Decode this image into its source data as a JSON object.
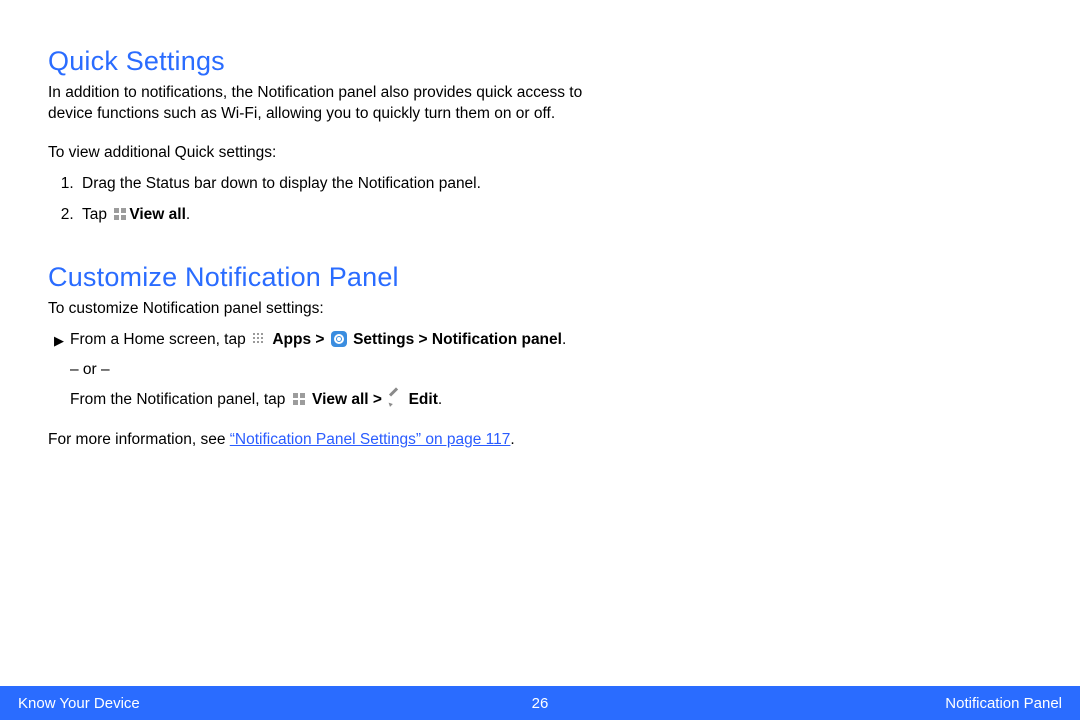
{
  "section1": {
    "heading": "Quick Settings",
    "intro": "In addition to notifications, the Notification panel also provides quick access to device functions such as Wi-Fi, allowing you to quickly turn them on or off.",
    "lead": "To view additional Quick settings:",
    "step1": "Drag the Status bar down to display the Notification panel.",
    "step2_pre": "Tap ",
    "step2_bold": "View all",
    "step2_post": "."
  },
  "section2": {
    "heading": "Customize Notification Panel",
    "lead": "To customize Notification panel settings:",
    "linePrefix": "From a Home screen, tap ",
    "apps": "Apps",
    "gt1": " > ",
    "settings": "Settings",
    "gt2": " > ",
    "notifpanel": "Notification panel",
    "dot1": ".",
    "or": "– or –",
    "alt_pre": "From the Notification panel, tap ",
    "viewall": "View all",
    "gt3": " > ",
    "edit": "Edit",
    "dot2": ".",
    "moreinfo_pre": "For more information, see ",
    "linktext": "“Notification Panel Settings” on page 117",
    "moreinfo_post": "."
  },
  "footer": {
    "left": "Know Your Device",
    "center": "26",
    "right": "Notification Panel"
  }
}
